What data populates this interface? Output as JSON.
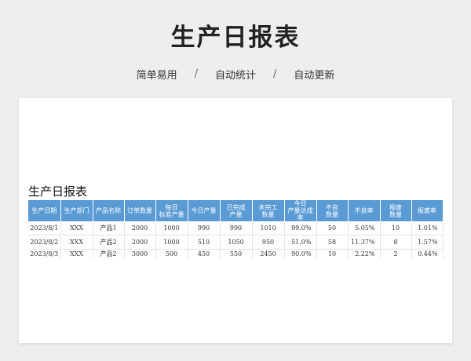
{
  "page": {
    "title": "生产日报表",
    "features": [
      "简单易用",
      "自动统计",
      "自动更新"
    ],
    "separator": "/"
  },
  "sheet": {
    "title": "生产日报表",
    "columns": [
      "生产日期",
      "生产部门",
      "产品名称",
      "订单数量",
      "每日\n标准产量",
      "今日产量",
      "已完成\n产量",
      "未完工\n数量",
      "今日\n产量达成\n率",
      "不良\n数量",
      "不良率",
      "报废\n数量",
      "报废率"
    ],
    "rows": [
      [
        "2023/8/1",
        "XXX",
        "产品1",
        "2000",
        "1000",
        "990",
        "990",
        "1010",
        "99.0%",
        "50",
        "5.05%",
        "10",
        "1.01%"
      ],
      [
        "2023/8/2",
        "XXX",
        "产品2",
        "2000",
        "1000",
        "510",
        "1050",
        "950",
        "51.0%",
        "58",
        "11.37%",
        "8",
        "1.57%"
      ],
      [
        "2023/8/3",
        "XXX",
        "产品2",
        "3000",
        "500",
        "450",
        "550",
        "2450",
        "90.0%",
        "10",
        "2.22%",
        "2",
        "0.44%"
      ]
    ]
  },
  "colors": {
    "header_bg": "#5b9bd5",
    "header_text": "#ffffff",
    "page_bg": "#eeeeee"
  }
}
